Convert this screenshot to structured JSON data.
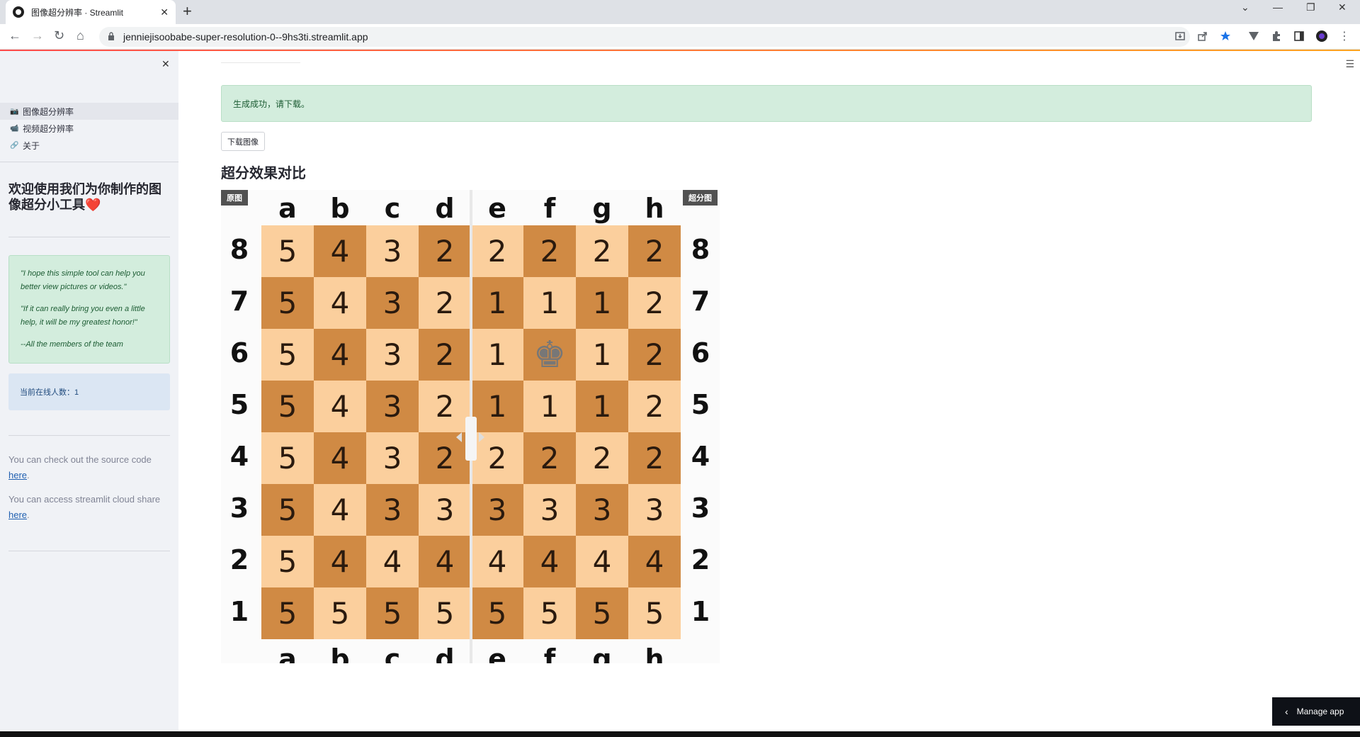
{
  "browser": {
    "tab_title": "图像超分辨率 · Streamlit",
    "url": "jenniejisoobabe-super-resolution-0--9hs3ti.streamlit.app"
  },
  "sidebar": {
    "nav": [
      {
        "icon": "📷",
        "label": "图像超分辨率"
      },
      {
        "icon": "📹",
        "label": "视频超分辨率"
      },
      {
        "icon": "🔗",
        "label": "关于"
      }
    ],
    "welcome": "欢迎使用我们为你制作的图像超分小工具",
    "welcome_heart": "❤️",
    "quote": [
      "\"I hope this simple tool can help you better view pictures or videos.\"",
      "\"If it can really bring you even a little help, it will be my greatest honor!\"",
      "--All the members of the team"
    ],
    "online": "当前在线人数：1",
    "source_text": "You can check out the source code",
    "source_link": "here",
    "share_text": "You can access streamlit cloud share",
    "share_link": "here",
    "period": "."
  },
  "main": {
    "success": "生成成功，请下载。",
    "download_label": "下载图像",
    "section_title": "超分效果对比",
    "left_label": "原图",
    "right_label": "超分图",
    "manage_label": "Manage app"
  },
  "board": {
    "files": [
      "a",
      "b",
      "c",
      "d",
      "e",
      "f",
      "g",
      "h"
    ],
    "ranks": [
      "8",
      "7",
      "6",
      "5",
      "4",
      "3",
      "2",
      "1"
    ],
    "cells": [
      [
        "5",
        "4",
        "3",
        "2",
        "2",
        "2",
        "2",
        "2"
      ],
      [
        "5",
        "4",
        "3",
        "2",
        "1",
        "1",
        "1",
        "2"
      ],
      [
        "5",
        "4",
        "3",
        "2",
        "1",
        "♚",
        "1",
        "2"
      ],
      [
        "5",
        "4",
        "3",
        "2",
        "1",
        "1",
        "1",
        "2"
      ],
      [
        "5",
        "4",
        "3",
        "2",
        "2",
        "2",
        "2",
        "2"
      ],
      [
        "5",
        "4",
        "3",
        "3",
        "3",
        "3",
        "3",
        "3"
      ],
      [
        "5",
        "4",
        "4",
        "4",
        "4",
        "4",
        "4",
        "4"
      ],
      [
        "5",
        "5",
        "5",
        "5",
        "5",
        "5",
        "5",
        "5"
      ]
    ]
  }
}
